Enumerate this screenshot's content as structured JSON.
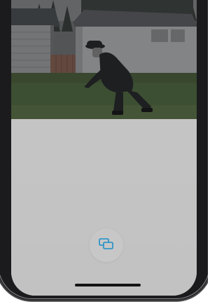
{
  "screen": {
    "background_color": "#c3c3c3"
  },
  "video": {
    "content": "backyard-scene"
  },
  "controls": {
    "mirror_button_icon": "screen-mirror-icon",
    "accent_color": "#1b8fc9"
  },
  "home_indicator": {
    "color": "#141414"
  }
}
